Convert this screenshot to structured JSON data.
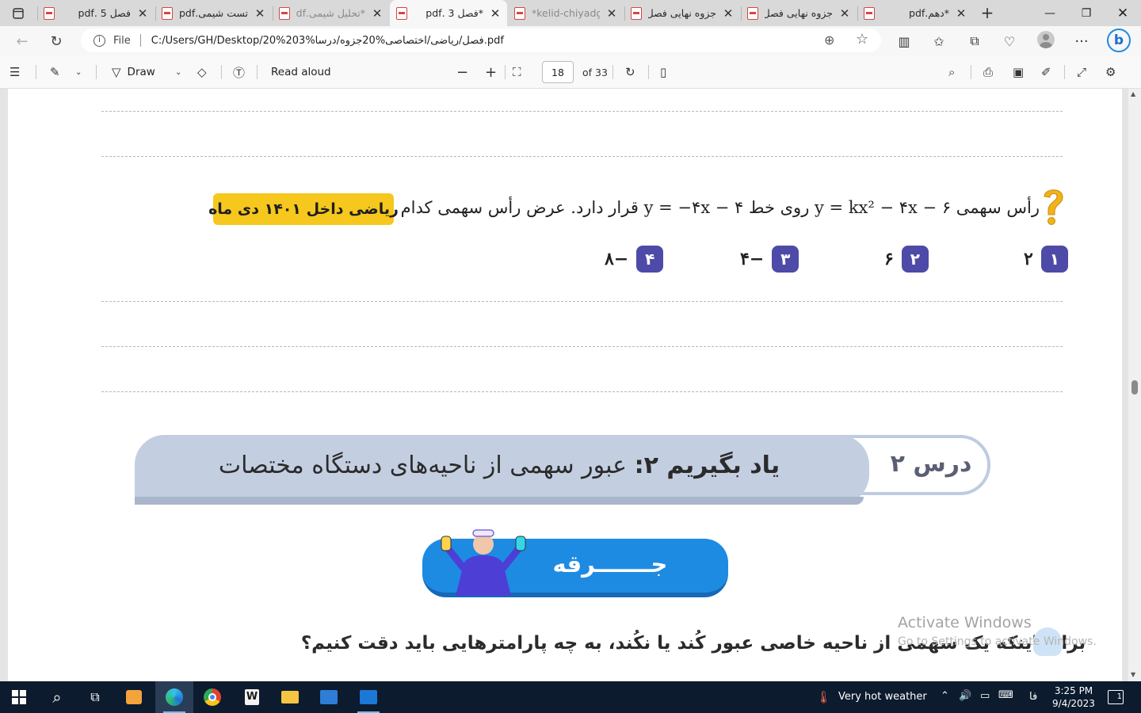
{
  "tabs": [
    {
      "title": "فصل 5 .pdf",
      "active": false,
      "faded": false
    },
    {
      "title": "تست شیمی.pdf",
      "active": false,
      "faded": false
    },
    {
      "title": "*تحلیل شیمی.pdf",
      "active": false,
      "faded": true
    },
    {
      "title": "*فصل 3 .pdf",
      "active": true,
      "faded": false
    },
    {
      "title": "*kelid-chiyadg",
      "active": false,
      "faded": true
    },
    {
      "title": "جزوه نهایی فصل",
      "active": false,
      "faded": false
    },
    {
      "title": "جزوه نهایی فصل",
      "active": false,
      "faded": false
    },
    {
      "title": "*دهم.pdf",
      "active": false,
      "faded": false
    }
  ],
  "address": {
    "file_label": "File",
    "url": "C:/Users/GH/Desktop/20%203%فصل/ریاضی/اختصاصی%20جزوه/درسا.pdf"
  },
  "pdf_toolbar": {
    "draw_label": "Draw",
    "read_aloud_label": "Read aloud",
    "page_current": "18",
    "page_total": "of 33"
  },
  "content": {
    "question_text": "رأس سهمی y = kx² − ۴x − ۶ روی خط y = −۴x − ۴ قرار دارد. عرض رأس سهمی کدام است؟",
    "badge": "ریاضی داخل ۱۴۰۱ دی ماه",
    "options": [
      {
        "num": "۱",
        "value": "۲"
      },
      {
        "num": "۲",
        "value": "۶"
      },
      {
        "num": "۳",
        "value": "−۴"
      },
      {
        "num": "۴",
        "value": "−۸"
      }
    ],
    "lesson_number": "درس ۲",
    "lesson_prefix": "یاد بگیریم ۲:",
    "lesson_title": "عبور سهمی از ناحیه‌های دستگاه مختصات",
    "spark_label": "جـــــــرقه",
    "bottom_question": "برای اینکه یک سهمی از ناحیه خاصی عبور کُند یا نکُند، به چه پارامترهایی باید دقت کنیم؟"
  },
  "watermark": {
    "title": "Activate Windows",
    "subtitle": "Go to Settings to activate Windows."
  },
  "taskbar": {
    "weather": "Very hot weather",
    "lang": "فا",
    "time": "3:25 PM",
    "date": "9/4/2023",
    "notif_count": "1"
  },
  "colors": {
    "option_badge": "#4e4aa8",
    "year_badge": "#f6c71d",
    "lesson_band": "#c3cfe1",
    "spark_banner": "#1e8be3"
  }
}
